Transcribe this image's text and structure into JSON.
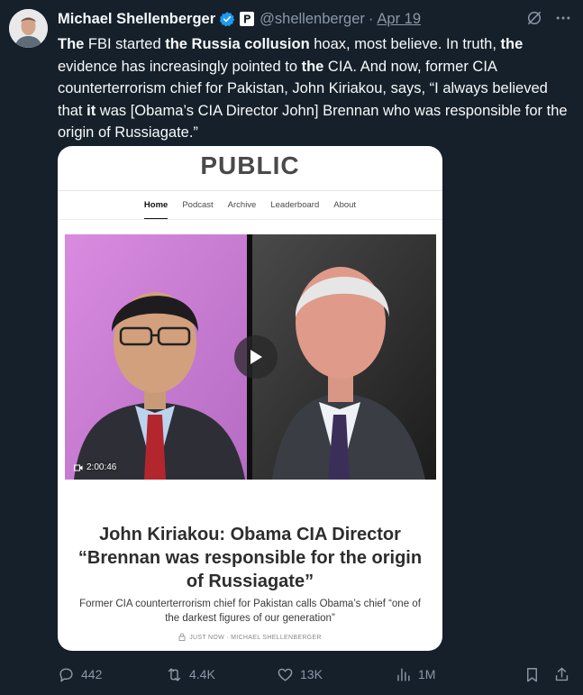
{
  "tweet": {
    "author_name": "Michael Shellenberger",
    "handle": "@shellenberger",
    "separator": "·",
    "date": "Apr 19",
    "text_parts": [
      {
        "t": "The",
        "b": true
      },
      {
        "t": " FBI started ",
        "b": false
      },
      {
        "t": "the Russia collusion",
        "b": true
      },
      {
        "t": " hoax, most believe. In truth, ",
        "b": false
      },
      {
        "t": "the",
        "b": true
      },
      {
        "t": " evidence has increasingly pointed to ",
        "b": false
      },
      {
        "t": "the",
        "b": true
      },
      {
        "t": " CIA. And now, former CIA counterterrorism chief for Pakistan, John Kiriakou, says, “I always believed that ",
        "b": false
      },
      {
        "t": "it",
        "b": true
      },
      {
        "t": " was [Obama’s CIA Director John] Brennan who was responsible for the origin of Russiagate.”",
        "b": false
      }
    ]
  },
  "card": {
    "logo": "PUBLIC",
    "nav": [
      "Home",
      "Podcast",
      "Archive",
      "Leaderboard",
      "About"
    ],
    "active_nav": "Home",
    "video_duration": "2:00:46",
    "headline": "John Kiriakou: Obama CIA Director “Brennan was responsible for the origin of Russiagate”",
    "subhead": "Former CIA counterterrorism chief for Pakistan calls Obama’s chief “one of the darkest figures of our generation”",
    "byline": "JUST NOW · MICHAEL SHELLENBERGER"
  },
  "actions": {
    "replies": "442",
    "reposts": "4.4K",
    "likes": "13K",
    "views": "1M"
  },
  "colors": {
    "background": "#15202b",
    "text": "#f7f9f9",
    "muted": "#8b98a5",
    "verified": "#1d9bf0"
  },
  "icons": [
    "grok-icon",
    "more-icon",
    "verified-badge-icon",
    "affiliate-badge-icon",
    "play-icon",
    "video-camera-icon",
    "lock-icon",
    "reply-icon",
    "repost-icon",
    "like-icon",
    "views-icon",
    "bookmark-icon",
    "share-icon"
  ]
}
